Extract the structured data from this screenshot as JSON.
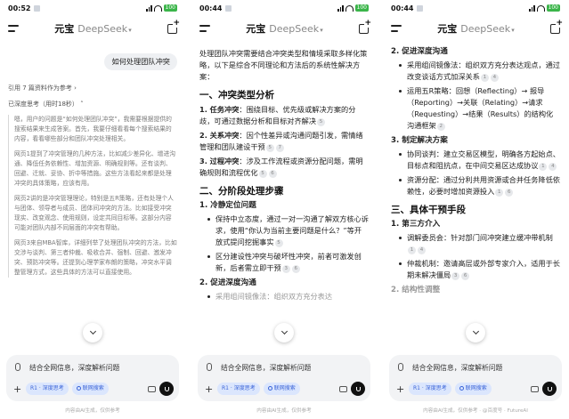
{
  "status": {
    "p1_time": "00:52",
    "p2_time": "00:44",
    "p3_time": "00:44",
    "battery": "100"
  },
  "header": {
    "brand": "元宝",
    "model": "DeepSeek"
  },
  "composer": {
    "placeholder": "结合全网信息，深度解析问题",
    "pill_r1": "R1 · 深度思考",
    "pill_web": "联网搜索"
  },
  "disclaimer": "内容由AI生成，仅供参考",
  "watermark": "@百度号 · FutureAI",
  "p1": {
    "question": "如何处理团队冲突",
    "refs": "引用 7 篇资料作为参考",
    "thought": "已深度思考（用时18秒）",
    "think": [
      "嗯，用户的问题是“如何处理团队冲突”，我需要根据提供的搜索结果来生成答案。首先，我要仔细看看每个搜索结果的内容，看看哪些部分和团队冲突处理相关。",
      "网页1提到了冲突管理的几种方法，比如减少差异化、增进沟通、降低任务依赖性、增加资源、明确规则等。还有谈判、回避、迁就、妥协、折中等措施。这些方法看起来都是处理冲突的具体策略，应该有用。",
      "网页2讲的是冲突管理理论，特别是五R策略，还有处理个人与团体、领导者与成员、团体间冲突的方法。比如接受冲突现实、改变观念、使用规则，设定共同目标等。这部分内容可能对团队内部不同层面的冲突有帮助。",
      "网页3来自MBA智库，详细列举了处理团队冲突的方法，比如交涉与谈判、第三者仲裁、吸收合并、强制、回避、激发冲突、预防冲突等。还提到心理学家布朗的策略，冲突水平调整管理方式，这些具体的方法可以直接使用。"
    ]
  },
  "p2": {
    "intro": "处理团队冲突需要结合冲突类型和情境采取多样化策略，以下是综合不同理论和方法后的系统性解决方案：",
    "h1": "一、冲突类型分析",
    "types": [
      {
        "label": "1. 任务冲突",
        "text": "：围绕目标、优先级或解决方案的分歧，可通过数据分析和目标对齐解决",
        "cites": [
          "5"
        ]
      },
      {
        "label": "2. 关系冲突",
        "text": "：因个性差异或沟通问题引发，需情绪管理和团队建设干预",
        "cites": [
          "5",
          "7"
        ]
      },
      {
        "label": "3. 过程冲突",
        "text": "：涉及工作流程或资源分配问题，需明确规则和流程优化",
        "cites": [
          "5",
          "6"
        ]
      }
    ],
    "h2": "二、分阶段处理步骤",
    "s1": "1. 冷静定位问题",
    "s1_items": [
      {
        "text": "保持中立态度，通过一对一沟通了解双方核心诉求，使用“你认为当前主要问题是什么？”等开放式提问挖掘事实",
        "cites": [
          "5"
        ]
      },
      {
        "text": "区分建设性冲突与破坏性冲突，前者可激发创新，后者需立即干预",
        "cites": [
          "3",
          "6"
        ]
      }
    ],
    "s2": "2. 促进深度沟通",
    "s2_partial": "采用组间镜像法：组织双方充分表达"
  },
  "p3": {
    "s2": "2. 促进深度沟通",
    "s2_items": [
      {
        "text": "采用组间镜像法：组织双方充分表达观点，通过改变谈话方式加深关系",
        "cites": [
          "1",
          "4"
        ]
      },
      {
        "text": "运用五R策略：回想（Reflecting）→ 报导（Reporting）→关联（Relating）→请求（Requesting）→结果（Results）的结构化沟通框架",
        "cites": [
          "2"
        ]
      }
    ],
    "s3": "3. 制定解决方案",
    "s3_items": [
      {
        "text": "协同谈判：建立交易区模型，明确各方起始点、目标点和阻抗点，在中间交易区达成协议",
        "cites": [
          "1",
          "4"
        ]
      },
      {
        "text": "资源分配：通过分利共用资源或合并任务降低依赖性，必要时增加资源投入",
        "cites": [
          "1",
          "6"
        ]
      }
    ],
    "h3": "三、具体干预手段",
    "t1": "1. 第三方介入",
    "t1_items": [
      {
        "text": "调解委员会：针对部门间冲突建立缓冲带机制",
        "cites": [
          "1",
          "4"
        ]
      },
      {
        "text": "仲裁机制：邀请高层或外部专家介入，适用于长期未解决僵局",
        "cites": [
          "3",
          "6"
        ]
      }
    ],
    "t2_partial": "2. 结构性调整"
  }
}
